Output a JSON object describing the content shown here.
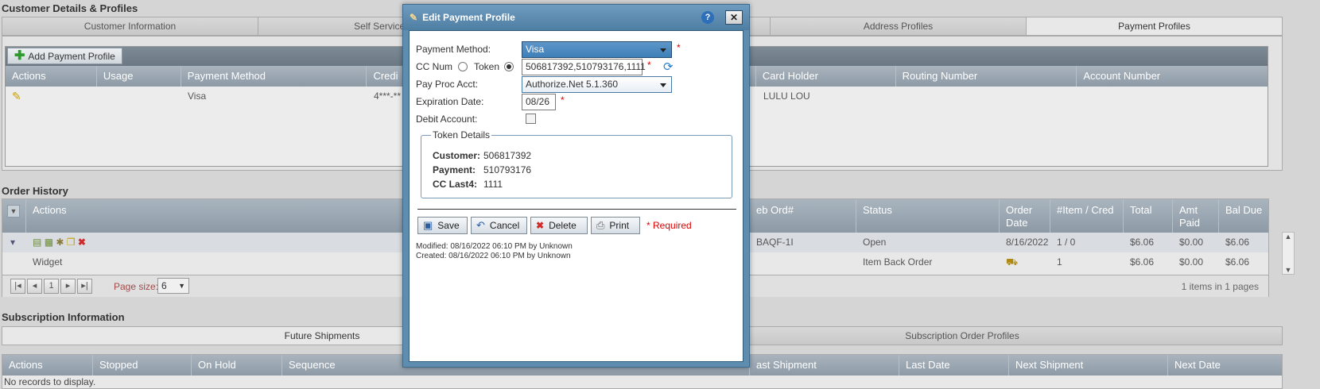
{
  "customer_section": {
    "title": "Customer Details & Profiles",
    "tabs": [
      "Customer Information",
      "Self Service Ac",
      "",
      "Address Profiles",
      "Payment Profiles"
    ],
    "add_button": "Add Payment Profile",
    "columns": [
      "Actions",
      "Usage",
      "Payment Method",
      "Credi",
      "Card Holder",
      "Routing Number",
      "Account Number"
    ],
    "row": {
      "payment_method": "Visa",
      "credit": "4***-**",
      "card_holder": "LULU LOU"
    }
  },
  "order_history": {
    "title": "Order History",
    "columns": [
      "Actions",
      "eb Ord#",
      "Status",
      "Order Date",
      "#Item / Cred",
      "Total",
      "Amt Paid",
      "Bal Due"
    ],
    "row": {
      "ord": "BAQF-1I",
      "status": "Open",
      "date": "8/16/2022",
      "items": "1 / 0",
      "total": "$6.06",
      "paid": "$0.00",
      "due": "$6.06"
    },
    "detail_row": {
      "name": "Widget",
      "status": "Item Back Order",
      "items": "1",
      "total": "$6.06",
      "paid": "$0.00",
      "due": "$6.06"
    },
    "pager": {
      "page": "1",
      "page_size_label": "Page size:",
      "page_size": "6",
      "summary": "1 items in 1 pages"
    }
  },
  "subscription": {
    "title": "Subscription Information",
    "tabs": [
      "Future Shipments",
      "Subscription Order Profiles"
    ],
    "columns": [
      "Actions",
      "Stopped",
      "On Hold",
      "Sequence",
      "ast Shipment",
      "Last Date",
      "Next Shipment",
      "Next Date"
    ],
    "empty": "No records to display."
  },
  "modal": {
    "title": "Edit Payment Profile",
    "payment_method_label": "Payment Method:",
    "payment_method_value": "Visa",
    "cc_num_label": "CC Num",
    "token_label": "Token",
    "cc_value": "506817392,510793176,1111",
    "pay_proc_label": "Pay Proc Acct:",
    "pay_proc_value": "Authorize.Net 5.1.360",
    "exp_label": "Expiration Date:",
    "exp_value": "08/26",
    "debit_label": "Debit Account:",
    "token_details_legend": "Token Details",
    "customer_label": "Customer:",
    "customer_value": "506817392",
    "payment_label": "Payment:",
    "payment_value": "510793176",
    "last4_label": "CC Last4:",
    "last4_value": "1111",
    "save": "Save",
    "cancel": "Cancel",
    "delete": "Delete",
    "print": "Print",
    "required_note": "* Required",
    "modified": "Modified: 08/16/2022 06:10 PM by Unknown",
    "created": "Created: 08/16/2022 06:10 PM by Unknown",
    "asterisk": "*"
  },
  "colors": {
    "header_blue": "#5f8db0",
    "grid_header": "#8d9aa6",
    "required": "#e00000"
  }
}
